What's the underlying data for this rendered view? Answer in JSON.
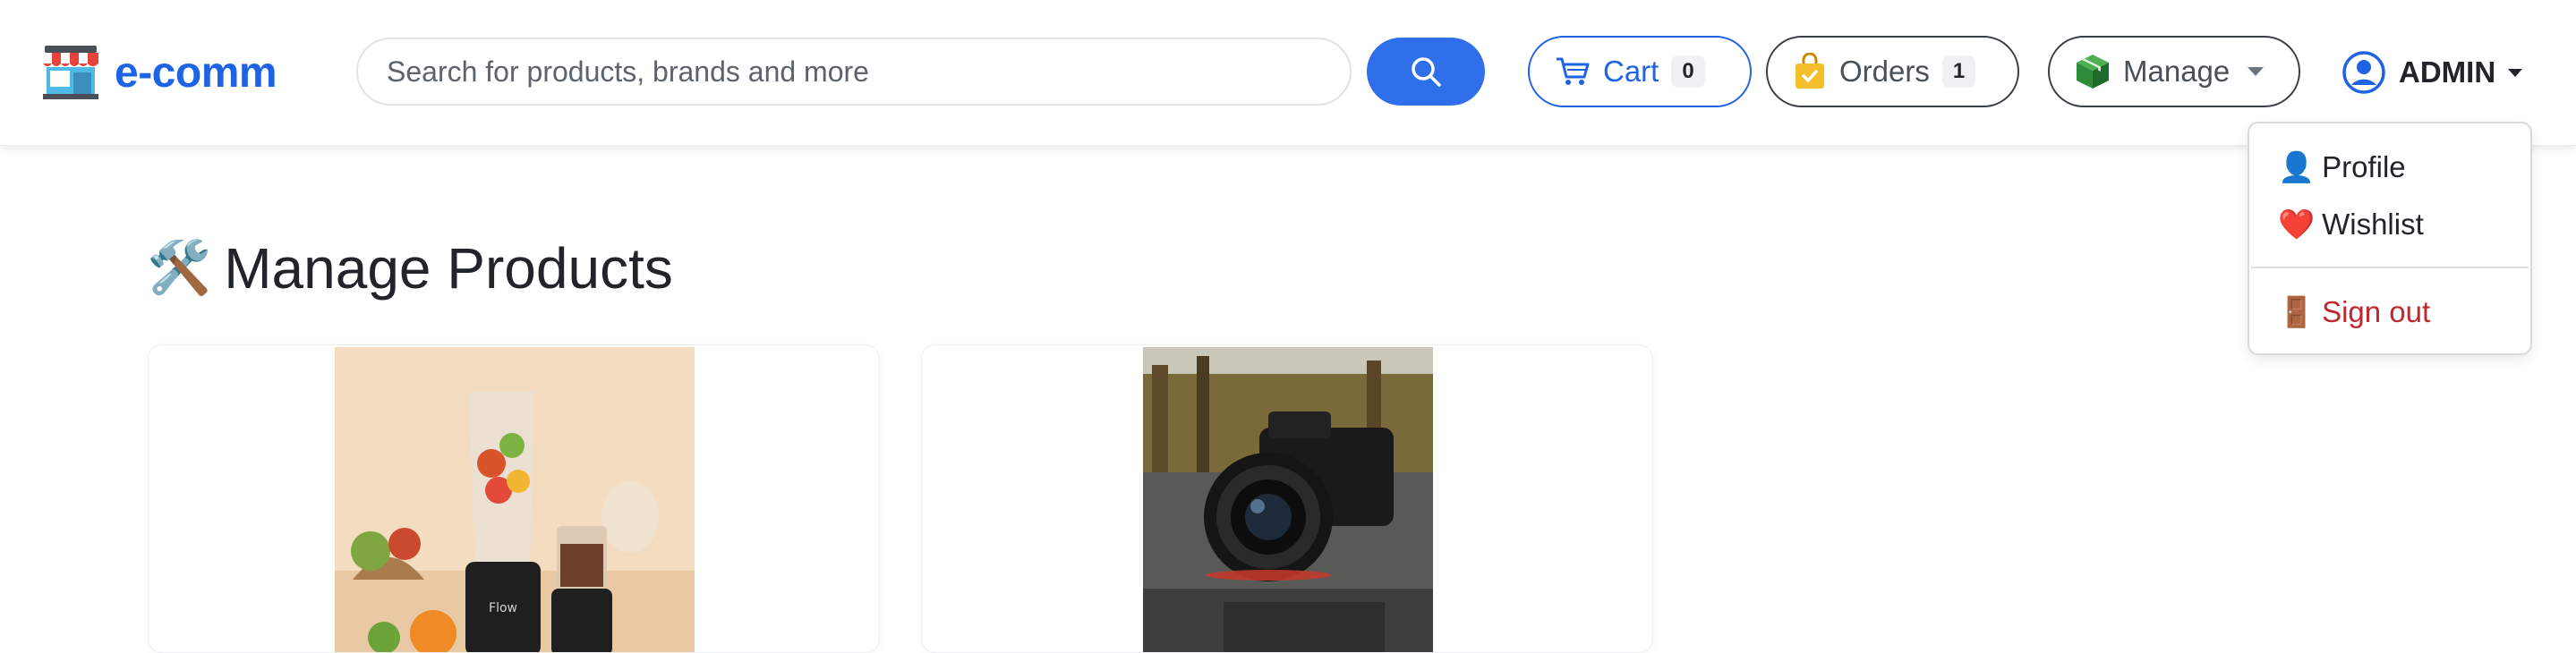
{
  "brand": {
    "name": "e-comm",
    "icon": "storefront-icon"
  },
  "search": {
    "placeholder": "Search for products, brands and more",
    "button_icon": "search-icon"
  },
  "nav": {
    "cart": {
      "label": "Cart",
      "count": "0",
      "icon": "cart-icon"
    },
    "orders": {
      "label": "Orders",
      "count": "1",
      "icon": "shopping-bag-icon"
    },
    "manage": {
      "label": "Manage",
      "icon": "package-icon"
    },
    "user": {
      "name": "ADMIN",
      "icon": "user-circle-icon"
    }
  },
  "user_menu": {
    "items": [
      {
        "icon": "👤",
        "label": "Profile"
      },
      {
        "icon": "❤️",
        "label": "Wishlist"
      },
      {
        "icon": "🚪",
        "label": "Sign out"
      }
    ]
  },
  "main": {
    "title_icon": "🛠️",
    "title": "Manage Products"
  },
  "colors": {
    "accent": "#1e63e6",
    "search_button": "#2f6fea",
    "danger": "#c0282d"
  }
}
